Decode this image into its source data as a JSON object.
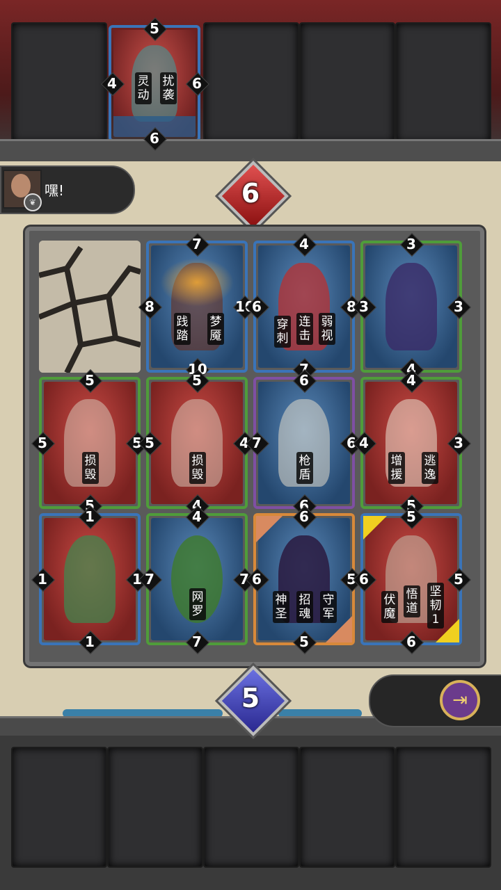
{
  "opponent": {
    "score": "6",
    "hand_card": {
      "top": "5",
      "right": "6",
      "bottom": "6",
      "left": "4",
      "abilities": [
        "灵动",
        "扰袭"
      ]
    }
  },
  "player": {
    "score": "5"
  },
  "chat": {
    "message": "嘿!"
  },
  "colors": {
    "red_team": "#a83838",
    "blue_team": "#3a80a8"
  },
  "board": [
    {
      "type": "rock"
    },
    {
      "top": "7",
      "right": "10",
      "bottom": "10",
      "left": "8",
      "abilities": [
        "践踏",
        "梦魇"
      ]
    },
    {
      "top": "4",
      "right": "8",
      "bottom": "7",
      "left": "6",
      "abilities": [
        "穿刺",
        "连击",
        "弱视"
      ]
    },
    {
      "top": "3",
      "right": "3",
      "bottom": "4",
      "left": "3",
      "abilities": []
    },
    {
      "top": "5",
      "right": "5",
      "bottom": "5",
      "left": "5",
      "abilities": [
        "损毁"
      ]
    },
    {
      "top": "5",
      "right": "4",
      "bottom": "4",
      "left": "5",
      "abilities": [
        "损毁"
      ]
    },
    {
      "top": "6",
      "right": "6",
      "bottom": "6",
      "left": "7",
      "abilities": [
        "枪盾"
      ]
    },
    {
      "top": "4",
      "right": "3",
      "bottom": "5",
      "left": "4",
      "abilities": [
        "增援",
        "逃逸"
      ]
    },
    {
      "top": "1",
      "right": "1",
      "bottom": "1",
      "left": "1",
      "abilities": []
    },
    {
      "top": "4",
      "right": "7",
      "bottom": "7",
      "left": "7",
      "abilities": [
        "网罗"
      ]
    },
    {
      "top": "6",
      "right": "5",
      "bottom": "5",
      "left": "6",
      "abilities": [
        "神圣",
        "招魂",
        "守军"
      ]
    },
    {
      "top": "5",
      "right": "5",
      "bottom": "6",
      "left": "6",
      "abilities": [
        "伏魔",
        "悟道",
        "坚韧1"
      ]
    }
  ],
  "icons": {
    "exit": "exit-door-icon",
    "chat_badge": "leaf-badge-icon"
  }
}
